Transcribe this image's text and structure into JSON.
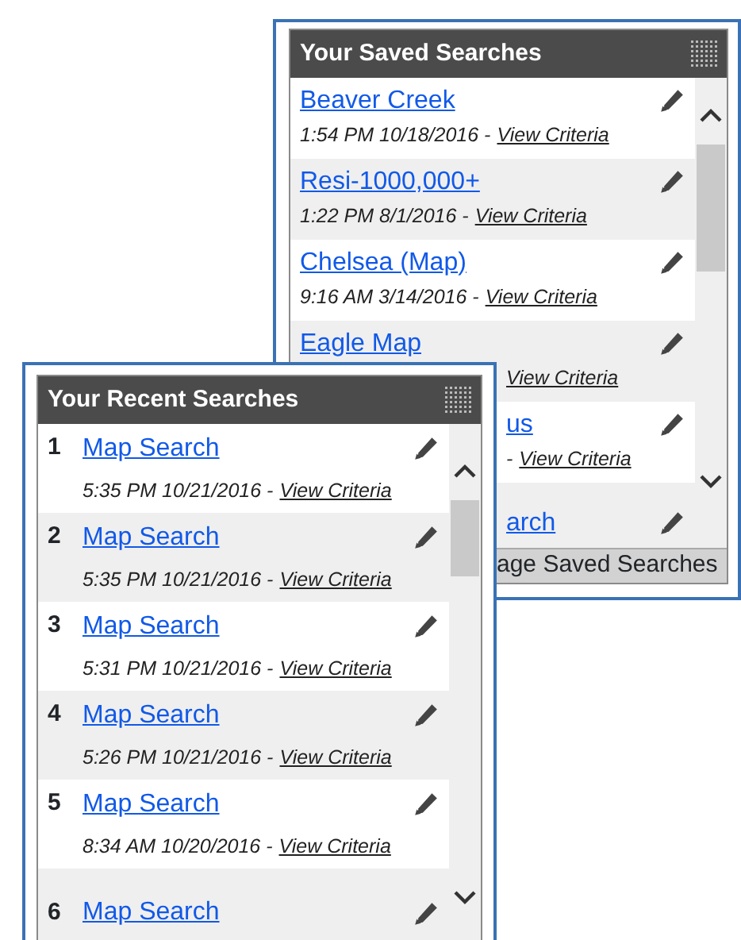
{
  "saved_panel": {
    "title": "Your Saved Searches",
    "items": [
      {
        "kind": "full",
        "name": "Beaver Creek",
        "time": "1:54 PM 10/18/2016 -",
        "link": "View Criteria"
      },
      {
        "kind": "full",
        "name": "Resi-1000,000+",
        "time": "1:22 PM 8/1/2016 -",
        "link": "View Criteria"
      },
      {
        "kind": "full",
        "name": "Chelsea (Map)",
        "time": "9:16 AM 3/14/2016 -",
        "link": "View Criteria"
      },
      {
        "kind": "meta_covered",
        "name": "Eagle Map",
        "link": "View Criteria"
      },
      {
        "kind": "covered",
        "name": "us",
        "time": "-",
        "link": "View Criteria"
      },
      {
        "kind": "covered",
        "name": "arch"
      }
    ],
    "footer_link": "age Saved Searches"
  },
  "recent_panel": {
    "title": "Your Recent Searches",
    "items": [
      {
        "number": "1",
        "name": "Map Search",
        "time": "5:35 PM 10/21/2016 -",
        "link": "View Criteria"
      },
      {
        "number": "2",
        "name": "Map Search",
        "time": "5:35 PM 10/21/2016 -",
        "link": "View Criteria"
      },
      {
        "number": "3",
        "name": "Map Search",
        "time": "5:31 PM 10/21/2016 -",
        "link": "View Criteria"
      },
      {
        "number": "4",
        "name": "Map Search",
        "time": "5:26 PM 10/21/2016 -",
        "link": "View Criteria"
      },
      {
        "number": "5",
        "name": "Map Search",
        "time": "8:34 AM 10/20/2016 -",
        "link": "View Criteria"
      },
      {
        "number": "6",
        "name": "Map Search"
      }
    ]
  }
}
